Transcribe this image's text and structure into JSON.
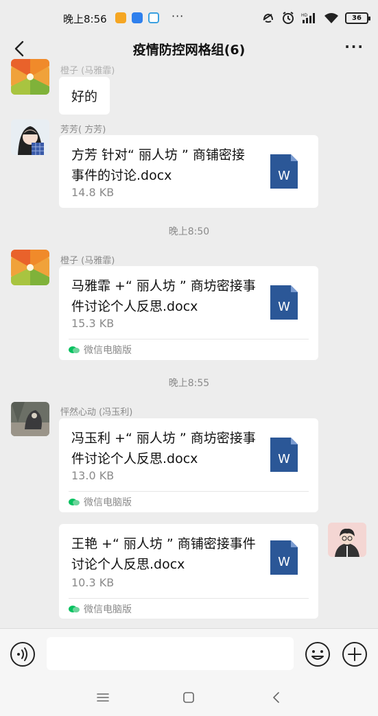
{
  "status_bar": {
    "time": "晚上8:56",
    "more": "···",
    "battery": "36"
  },
  "header": {
    "title": "疫情防控网格组(6)",
    "more": "···"
  },
  "messages": {
    "m0": {
      "sender": "橙子 (马雅霏)",
      "text": "好的"
    },
    "m1": {
      "sender": "芳芳( 方芳)",
      "file_name": "方芳 针对“ 丽人坊 ” 商铺密接事件的讨论.docx",
      "file_size": "14.8 KB"
    },
    "t1": "晚上8:50",
    "m2": {
      "sender": "橙子 (马雅霏)",
      "file_name": "马雅霏 +“ 丽人坊 ” 商坊密接事件讨论个人反思.docx",
      "file_size": "15.3 KB",
      "source": "微信电脑版"
    },
    "t2": "晚上8:55",
    "m3": {
      "sender": "怦然心动 (冯玉利)",
      "file_name": "冯玉利 +“ 丽人坊 ” 商坊密接事件讨论个人反思.docx",
      "file_size": "13.0 KB",
      "source": "微信电脑版"
    },
    "m4": {
      "file_name": "王艳 +“ 丽人坊 ” 商铺密接事件讨论个人反思.docx",
      "file_size": "10.3 KB",
      "source": "微信电脑版"
    }
  },
  "input": {
    "placeholder": ""
  },
  "colors": {
    "background": "#ededed",
    "bubble": "#ffffff",
    "word_blue": "#2b5797",
    "wechat_green": "#07c160"
  },
  "icons": [
    "back-icon",
    "more-icon",
    "voice-icon",
    "emoji-icon",
    "plus-icon",
    "word-file-icon",
    "wechat-pc-icon",
    "menu-icon",
    "home-icon",
    "nav-back-icon"
  ]
}
